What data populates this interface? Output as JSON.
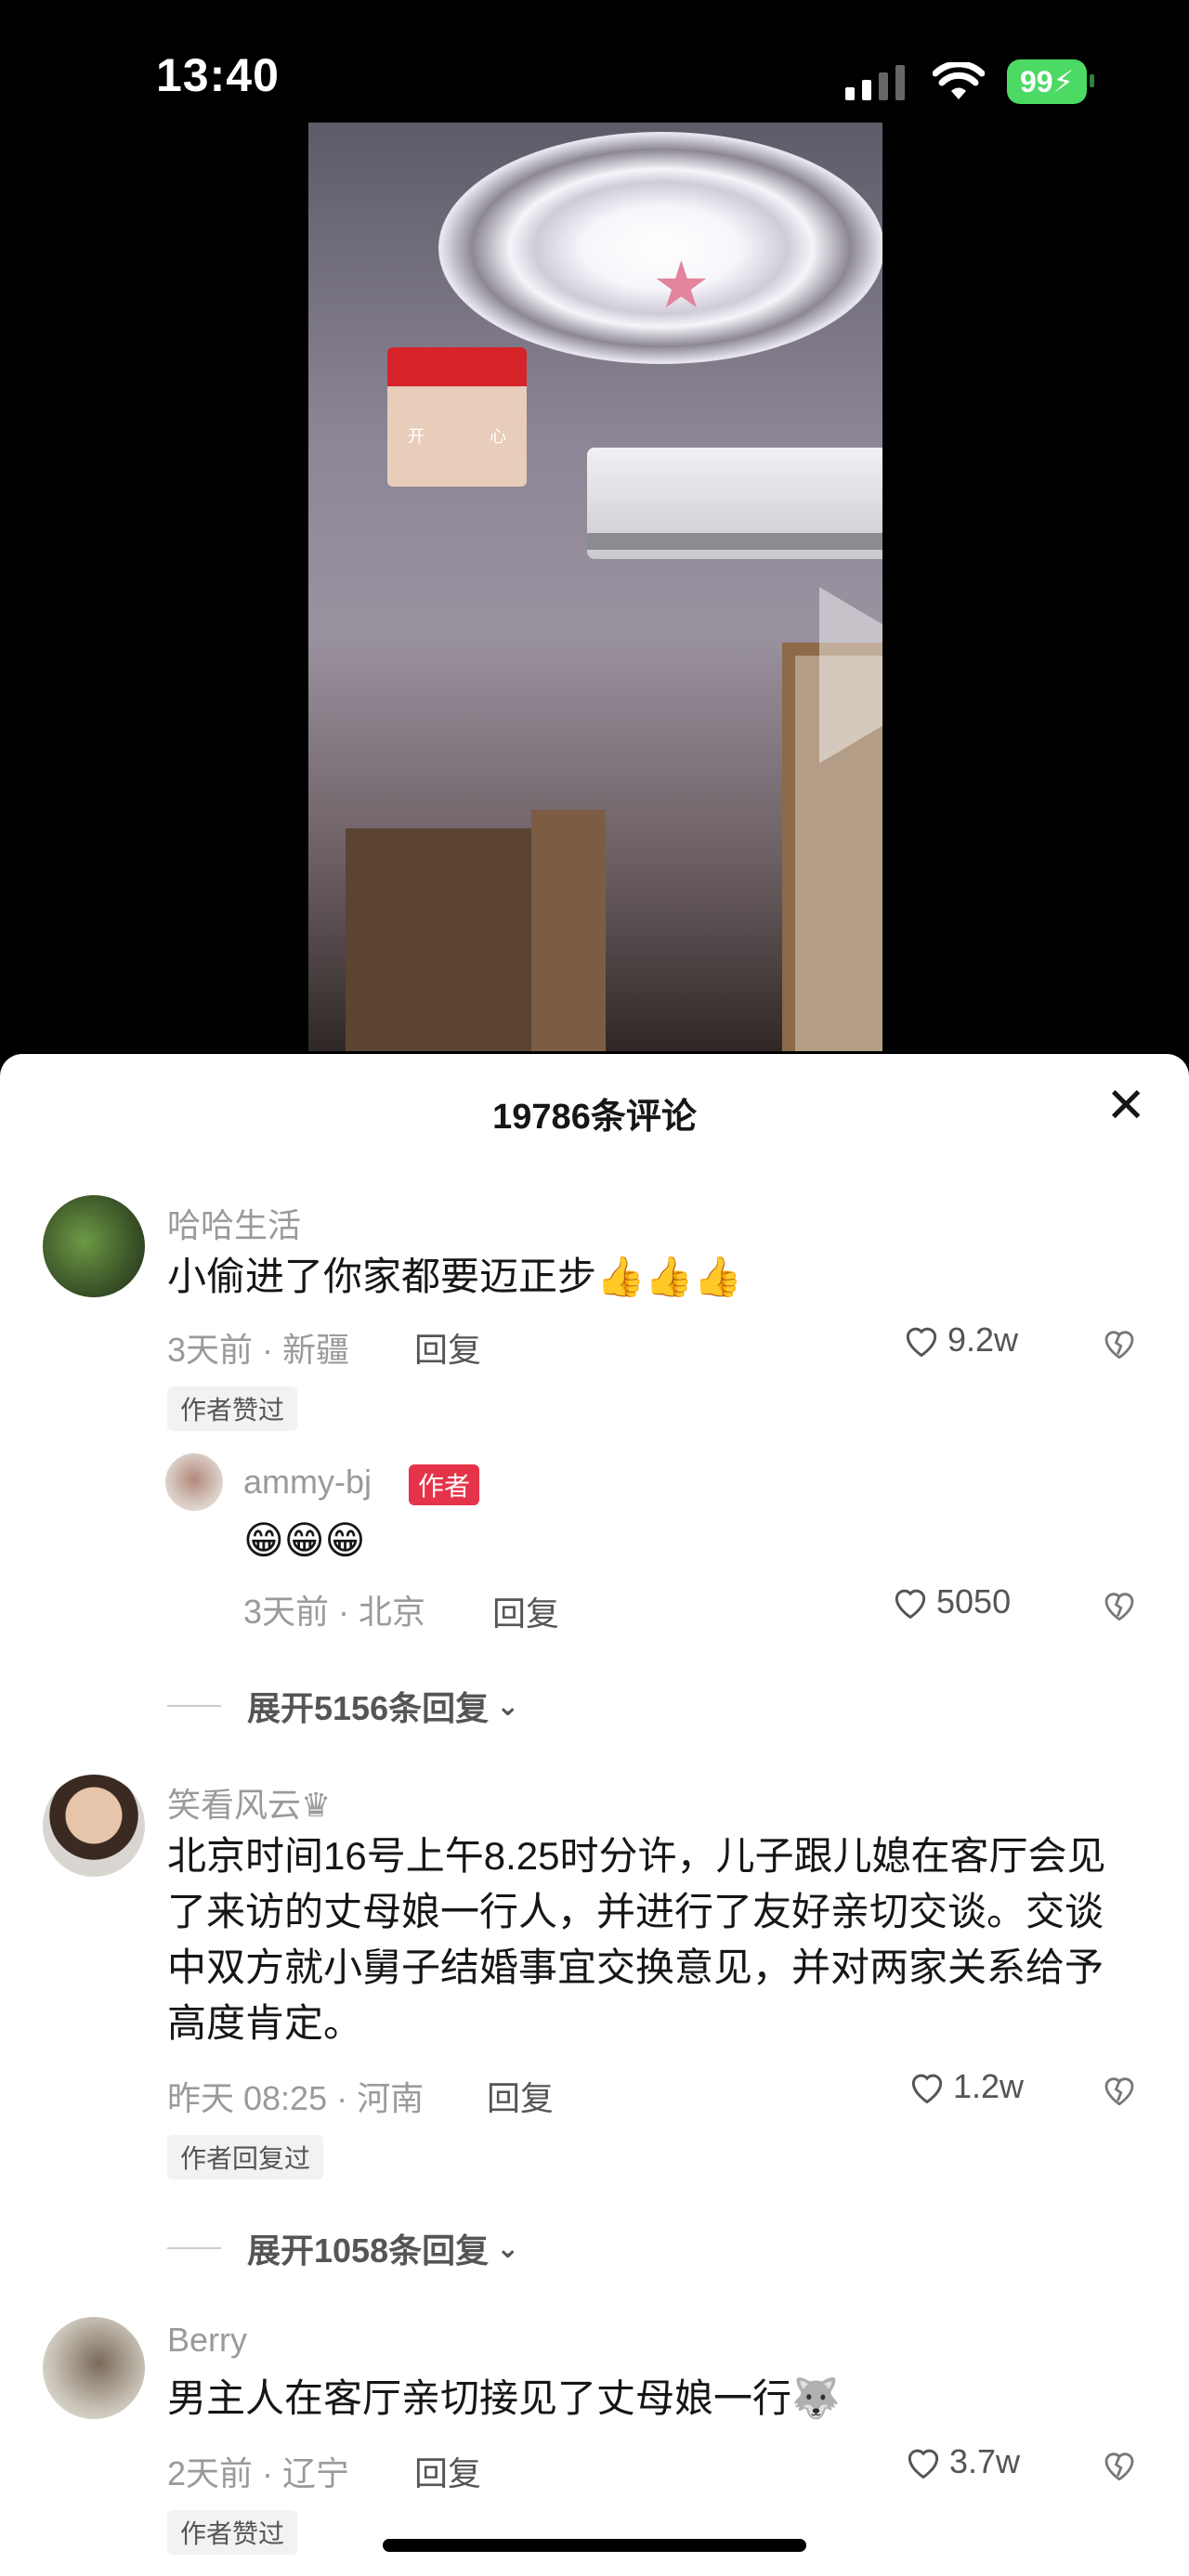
{
  "status": {
    "time": "13:40",
    "battery": "99"
  },
  "video": {
    "sticker_left": "开",
    "sticker_right": "心"
  },
  "sheet": {
    "title": "19786条评论"
  },
  "comments": [
    {
      "name": "哈哈生活",
      "text": "小偷进了你家都要迈正步👍👍👍",
      "meta": "3天前 · 新疆",
      "reply": "回复",
      "likes": "9.2w",
      "tag": "作者赞过",
      "sub_reply": {
        "name": "ammy-bj",
        "badge": "作者",
        "text": "😁😁😁",
        "meta": "3天前 · 北京",
        "reply": "回复",
        "likes": "5050"
      },
      "expand": "展开5156条回复"
    },
    {
      "name": "笑看风云♛",
      "text": "北京时间16号上午8.25时分许，儿子跟儿媳在客厅会见了来访的丈母娘一行人，并进行了友好亲切交谈。交谈中双方就小舅子结婚事宜交换意见，并对两家关系给予高度肯定。",
      "meta": "昨天 08:25 · 河南",
      "reply": "回复",
      "likes": "1.2w",
      "tag": "作者回复过",
      "expand": "展开1058条回复"
    },
    {
      "name": "Berry",
      "text": "男主人在客厅亲切接见了丈母娘一行🐺",
      "meta": "2天前 · 辽宁",
      "reply": "回复",
      "likes": "3.7w",
      "tag": "作者赞过"
    }
  ]
}
